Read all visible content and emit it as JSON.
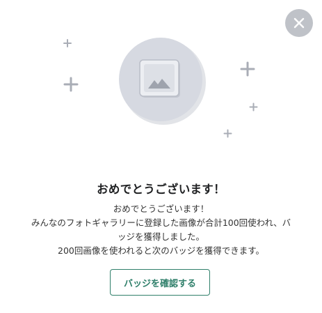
{
  "badge_dialog": {
    "close_icon": "close-icon",
    "badge_icon": "image-placeholder-icon",
    "sparkle_icon": "sparkle-plus-icon",
    "title": "おめでとうございます！",
    "message_lines": [
      "おめでとうございます！",
      "みんなのフォトギャラリーに登録した画像が合計100回使われ、バ",
      "ッジを獲得しました。",
      "200回画像を使われると次のバッジを獲得できます。"
    ],
    "confirm_button_label": "バッジを確認する"
  },
  "colors": {
    "accent": "#2f7f6a",
    "close_bg": "#bfc2c8",
    "badge_circle": "#d6d9e1",
    "sparkle": "#a9adb6"
  }
}
